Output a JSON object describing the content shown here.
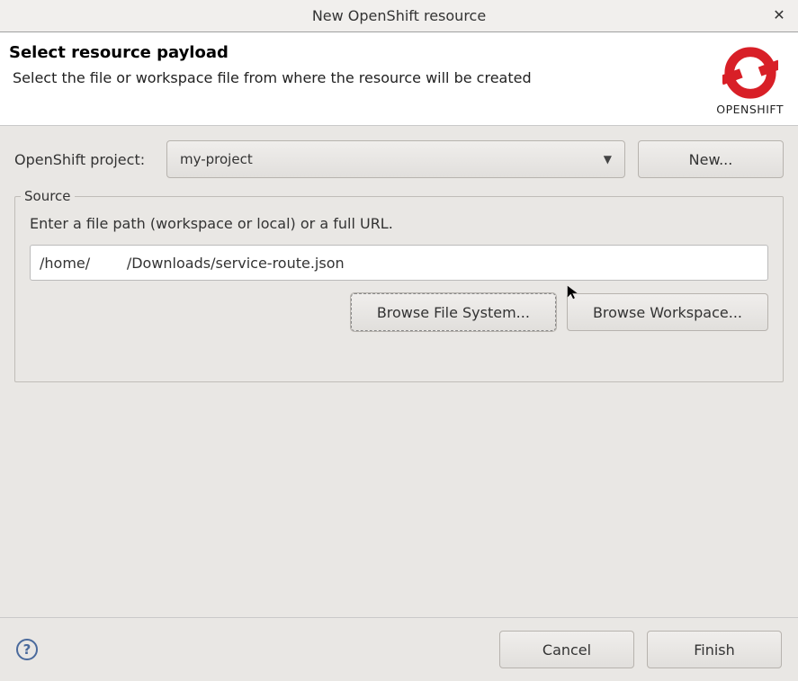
{
  "window": {
    "title": "New OpenShift resource",
    "close_glyph": "✕"
  },
  "banner": {
    "heading": "Select resource payload",
    "subtext": "Select the file or workspace file from where the resource will be created",
    "logo_text": "OPENSHIFT"
  },
  "project": {
    "label": "OpenShift project:",
    "selected": "my-project",
    "new_button": "New..."
  },
  "source": {
    "legend": "Source",
    "hint": "Enter a file path (workspace or local) or a full URL.",
    "path_value": "/home/        /Downloads/service-route.json",
    "browse_fs": "Browse File System...",
    "browse_ws": "Browse Workspace..."
  },
  "footer": {
    "help_glyph": "?",
    "cancel": "Cancel",
    "finish": "Finish"
  },
  "colors": {
    "openshift_red": "#d81f27"
  }
}
